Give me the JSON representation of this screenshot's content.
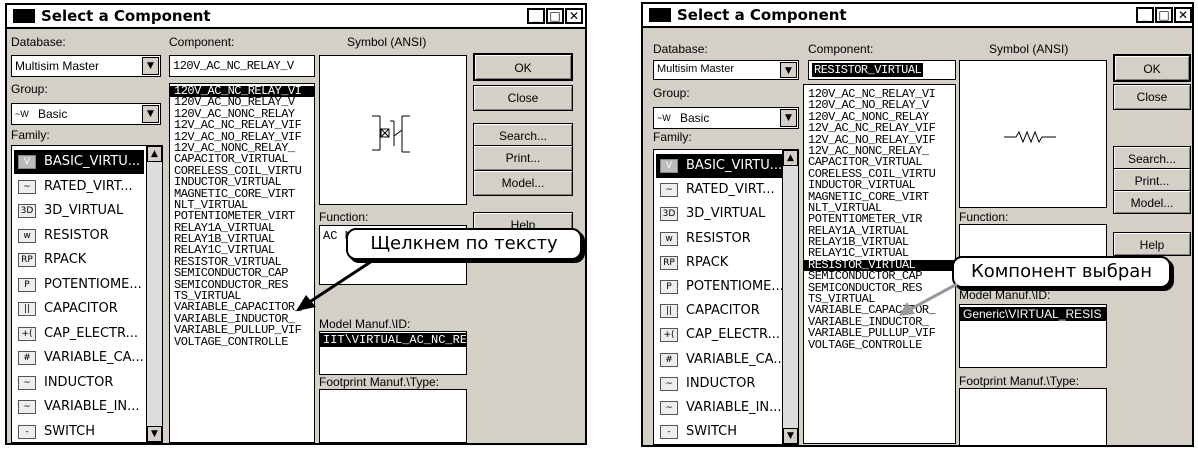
{
  "left": {
    "title": "Select a Component",
    "labels": {
      "database": "Database:",
      "component": "Component:",
      "symbol": "Symbol (ANSI)",
      "group": "Group:",
      "family": "Family:",
      "function": "Function:",
      "model": "Model Manuf.\\ID:",
      "footprint": "Footprint Manuf.\\Type:"
    },
    "database_value": "Multisim Master",
    "group_value": "Basic",
    "component_value": "120V_AC_NC_RELAY_V",
    "function_value": "AC N",
    "model_value": "IIT\\VIRTUAL_AC_NC_RE",
    "buttons": {
      "ok": "OK",
      "close": "Close",
      "search": "Search...",
      "print": "Print...",
      "model": "Model...",
      "help": "Help"
    },
    "callout": "Щелкнем по тексту"
  },
  "right": {
    "title": "Select a Component",
    "labels": {
      "database": "Database:",
      "component": "Component:",
      "symbol": "Symbol (ANSI)",
      "group": "Group:",
      "family": "Family:",
      "function": "Function:",
      "model": "Model Manuf.\\ID:",
      "footprint": "Footprint Manuf.\\Type:"
    },
    "database_value": "Multisim Master",
    "group_value": "Basic",
    "component_value": "RESISTOR_VIRTUAL",
    "function_value": "",
    "model_value": "Generic\\VIRTUAL_RESIS",
    "buttons": {
      "ok": "OK",
      "close": "Close",
      "search": "Search...",
      "print": "Print...",
      "model": "Model...",
      "help": "Help"
    },
    "callout": "Компонент выбран"
  },
  "families": [
    "BASIC_VIRTU...",
    "RATED_VIRT...",
    "3D_VIRTUAL",
    "RESISTOR",
    "RPACK",
    "POTENTIOME...",
    "CAPACITOR",
    "CAP_ELECTR...",
    "VARIABLE_CA...",
    "INDUCTOR",
    "VARIABLE_IN...",
    "SWITCH"
  ],
  "family_icons": [
    "V",
    "~",
    "3D",
    "w",
    "RP",
    "P",
    "||",
    "+(",
    "#",
    "~",
    "~",
    "-"
  ],
  "components_left": [
    "120V_AC_NC_RELAY_VI",
    "120V_AC_NO_RELAY_V",
    "120V_AC_NONC_RELAY",
    "12V_AC_NC_RELAY_VIF",
    "12V_AC_NO_RELAY_VIF",
    "12V_AC_NONC_RELAY_",
    "CAPACITOR_VIRTUAL",
    "CORELESS_COIL_VIRTU",
    "INDUCTOR_VIRTUAL",
    "MAGNETIC_CORE_VIRT",
    "NLT_VIRTUAL",
    "POTENTIOMETER_VIRT",
    "RELAY1A_VIRTUAL",
    "RELAY1B_VIRTUAL",
    "RELAY1C_VIRTUAL",
    "RESISTOR_VIRTUAL",
    "SEMICONDUCTOR_CAP",
    "SEMICONDUCTOR_RES",
    "TS_VIRTUAL",
    "VARIABLE_CAPACITOR_",
    "VARIABLE_INDUCTOR_",
    "VARIABLE_PULLUP_VIF",
    "VOLTAGE_CONTROLLE"
  ],
  "components_right": [
    "120V_AC_NC_RELAY_VI",
    "120V_AC_NO_RELAY_V",
    "120V_AC_NONC_RELAY",
    "12V_AC_NC_RELAY_VIF",
    "12V_AC_NO_RELAY_VIF",
    "12V_AC_NONC_RELAY_",
    "CAPACITOR_VIRTUAL",
    "CORELESS_COIL_VIRTU",
    "INDUCTOR_VIRTUAL",
    "MAGNETIC_CORE_VIRT",
    "NLT_VIRTUAL",
    "POTENTIOMETER_VIR",
    "RELAY1A_VIRTUAL",
    "RELAY1B_VIRTUAL",
    "RELAY1C_VIRTUAL",
    "RESISTOR_VIRTUAL",
    "SEMICONDUCTOR_CAP",
    "SEMICONDUCTOR_RES",
    "TS_VIRTUAL",
    "VARIABLE_CAPACITOR_",
    "VARIABLE_INDUCTOR_",
    "VARIABLE_PULLUP_VIF",
    "VOLTAGE_CONTROLLE"
  ],
  "left_selected_component_index": 0,
  "right_selected_component_index": 15
}
